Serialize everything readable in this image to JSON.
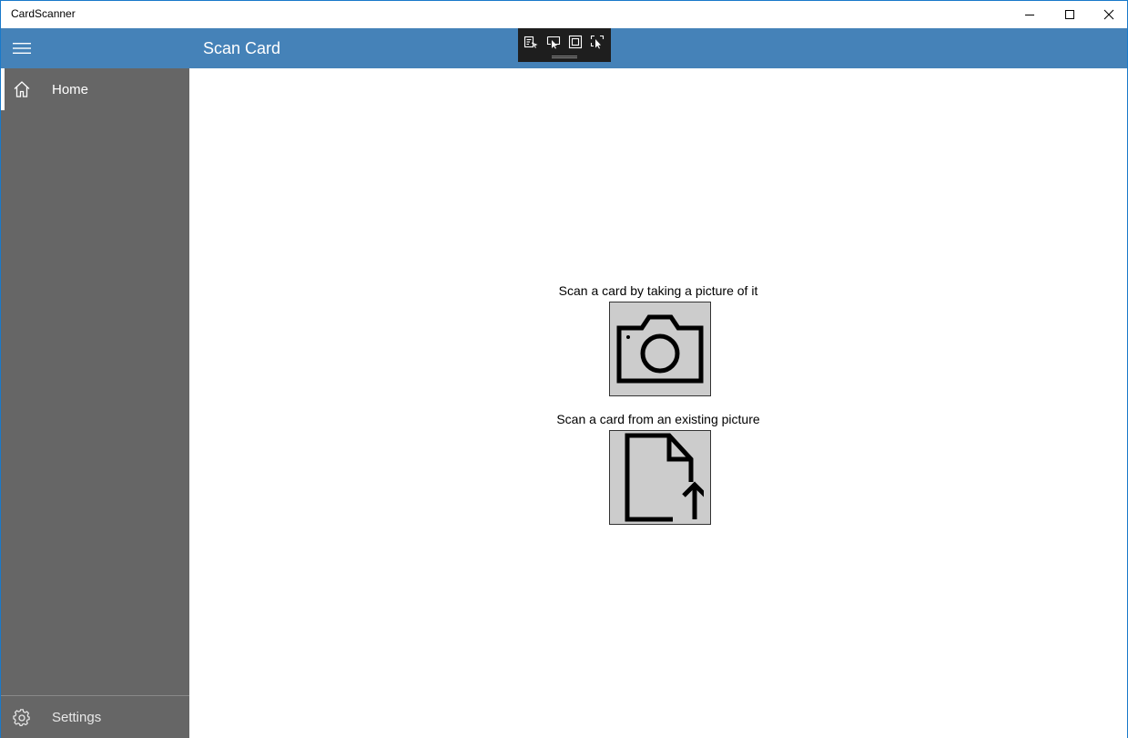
{
  "window": {
    "title": "CardScanner",
    "controls": {
      "minimize_icon": "minimize-icon",
      "maximize_icon": "maximize-icon",
      "close_icon": "close-icon"
    }
  },
  "header": {
    "title": "Scan Card",
    "menu_icon": "hamburger-icon",
    "color": "#4582b8"
  },
  "debug_toolbar": {
    "icons": [
      "live-visual-tree-icon",
      "select-element-icon",
      "display-layout-adorners-icon",
      "track-focus-icon"
    ]
  },
  "sidebar": {
    "background": "#666666",
    "items": [
      {
        "label": "Home",
        "icon": "home-icon",
        "selected": true
      }
    ],
    "footer": {
      "label": "Settings",
      "icon": "gear-icon"
    }
  },
  "main": {
    "actions": [
      {
        "label": "Scan a card by taking a picture of it",
        "icon": "camera-icon"
      },
      {
        "label": "Scan a card from an existing picture",
        "icon": "file-upload-icon"
      }
    ],
    "button_color": "#cccccc"
  }
}
